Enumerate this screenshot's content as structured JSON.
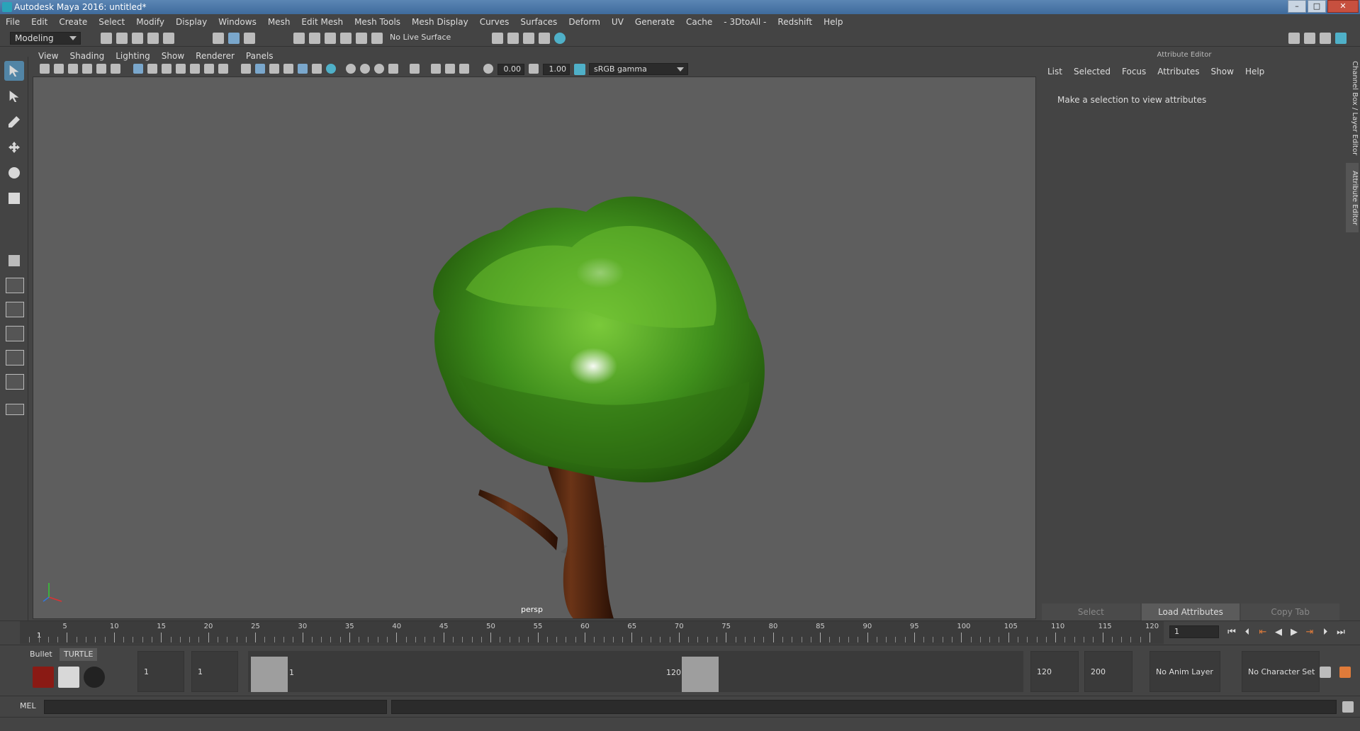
{
  "window": {
    "title": "Autodesk Maya 2016: untitled*"
  },
  "menubar": [
    "File",
    "Edit",
    "Create",
    "Select",
    "Modify",
    "Display",
    "Windows",
    "Mesh",
    "Edit Mesh",
    "Mesh Tools",
    "Mesh Display",
    "Curves",
    "Surfaces",
    "Deform",
    "UV",
    "Generate",
    "Cache",
    "- 3DtoAll -",
    "Redshift",
    "Help"
  ],
  "shelf": {
    "mode": "Modeling",
    "live_surface": "No Live Surface"
  },
  "viewport": {
    "menu": [
      "View",
      "Shading",
      "Lighting",
      "Show",
      "Renderer",
      "Panels"
    ],
    "exposure": "0.00",
    "gamma_value": "1.00",
    "color_space": "sRGB gamma",
    "camera_label": "persp"
  },
  "attribute_editor": {
    "title": "Attribute Editor",
    "menu": [
      "List",
      "Selected",
      "Focus",
      "Attributes",
      "Show",
      "Help"
    ],
    "message": "Make a selection to view attributes",
    "buttons": [
      "Select",
      "Load Attributes",
      "Copy Tab"
    ],
    "side_tabs": [
      "Channel Box / Layer Editor",
      "Attribute Editor"
    ]
  },
  "timeline": {
    "ticks": [
      "5",
      "10",
      "15",
      "20",
      "25",
      "30",
      "35",
      "40",
      "45",
      "50",
      "55",
      "60",
      "65",
      "70",
      "75",
      "80",
      "85",
      "90",
      "95",
      "100",
      "105",
      "110",
      "115",
      "120"
    ],
    "current_frame": "1",
    "frame_field": "1"
  },
  "range": {
    "shelf_tabs": [
      "Bullet",
      "TURTLE"
    ],
    "start": "1",
    "playback_start": "1",
    "slider_start": "1",
    "slider_end": "120",
    "playback_end": "120",
    "end": "200",
    "anim_layer": "No Anim Layer",
    "character_set": "No Character Set"
  },
  "command_line": {
    "label": "MEL"
  }
}
